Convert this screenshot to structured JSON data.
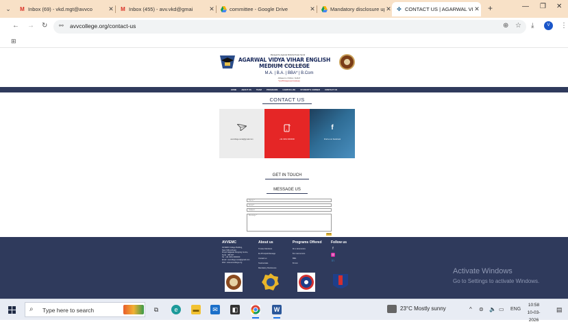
{
  "browser": {
    "tabs": [
      {
        "title": "Inbox (69) - vkd.mgt@avvco",
        "icon": "gmail-icon",
        "active": false
      },
      {
        "title": "Inbox (455) - avv.vkd@gmai",
        "icon": "gmail-icon",
        "active": false
      },
      {
        "title": "committee - Google Drive",
        "icon": "google-drive-icon",
        "active": false
      },
      {
        "title": "Mandatory disclosure upda",
        "icon": "google-drive-icon",
        "active": false
      },
      {
        "title": "CONTACT US | AGARWAL VI",
        "icon": "site-favicon",
        "active": true
      }
    ],
    "url": "avvcollege.org/contact-us",
    "profile_initial": "V"
  },
  "site": {
    "tagline": "Managed by Agarwal Shiksha Prasar Samiti",
    "college_name": "AGARWAL VIDYA VIHAR ENGLISH MEDIUM COLLEGE",
    "subline": "RECOGNISED BY GOVT. OF MAHARASHTRA",
    "degrees": "M.A.  |  B.A.  |  BBA*  |  B.Com",
    "affiliation": "Affiliated to VNSGU, SURAT",
    "affiliation_note": "*(A ATM Approved Institute)",
    "nav": [
      "HOME",
      "ABOUT US",
      "TEAM",
      "PROGRAMS",
      "CAMPUS LIFE",
      "STUDENT'S CORNER",
      "CONTACT US"
    ]
  },
  "contact": {
    "title": "CONTACT US",
    "cards": [
      {
        "icon": "send-icon",
        "text": "avvcollege.surat@gmail.com"
      },
      {
        "icon": "phone-icon",
        "text": "+91 0261 0000000"
      },
      {
        "icon": "facebook-icon",
        "text": "Find us on Facebook"
      }
    ],
    "get_in_touch": "GET IN TOUCH",
    "message_us": "MESSAGE US",
    "form": {
      "name_placeholder": "Name *",
      "email_placeholder": "Email *",
      "subject_placeholder": "Subject",
      "message_placeholder": "Message *",
      "send_label": "Send"
    }
  },
  "footer": {
    "col1": {
      "heading": "AVVEMC",
      "lines": [
        "AVVEMC College Building,",
        "Near Vidhya Road,",
        "Pimpri Nagpada Shopping Centre,",
        "Surat - 395 007",
        "",
        "Tel : +91 0261 0000000",
        "Email : avvcollege.surat@gmail.com",
        "Web : www.avvcollege.org"
      ]
    },
    "col2": {
      "heading": "About us",
      "items": [
        "Trustee Members",
        "Ex-Principal Message",
        "Contact us",
        "Testimonials",
        "Mandatory Disclosures"
      ]
    },
    "col3": {
      "heading": "Programs Offered",
      "items": [
        "M.A. Economics",
        "B.A. Economics",
        "BBA",
        "B.Com"
      ]
    },
    "col4": {
      "heading": "Follow us",
      "icons": [
        "facebook-icon",
        "instagram-icon",
        "linkedin-icon"
      ]
    },
    "activate_title": "Activate Windows",
    "activate_sub": "Go to Settings to activate Windows."
  },
  "taskbar": {
    "search_placeholder": "Type here to search",
    "weather": "23°C  Mostly sunny",
    "language": "ENG",
    "time": "10:58",
    "date": "10-03-2026"
  }
}
